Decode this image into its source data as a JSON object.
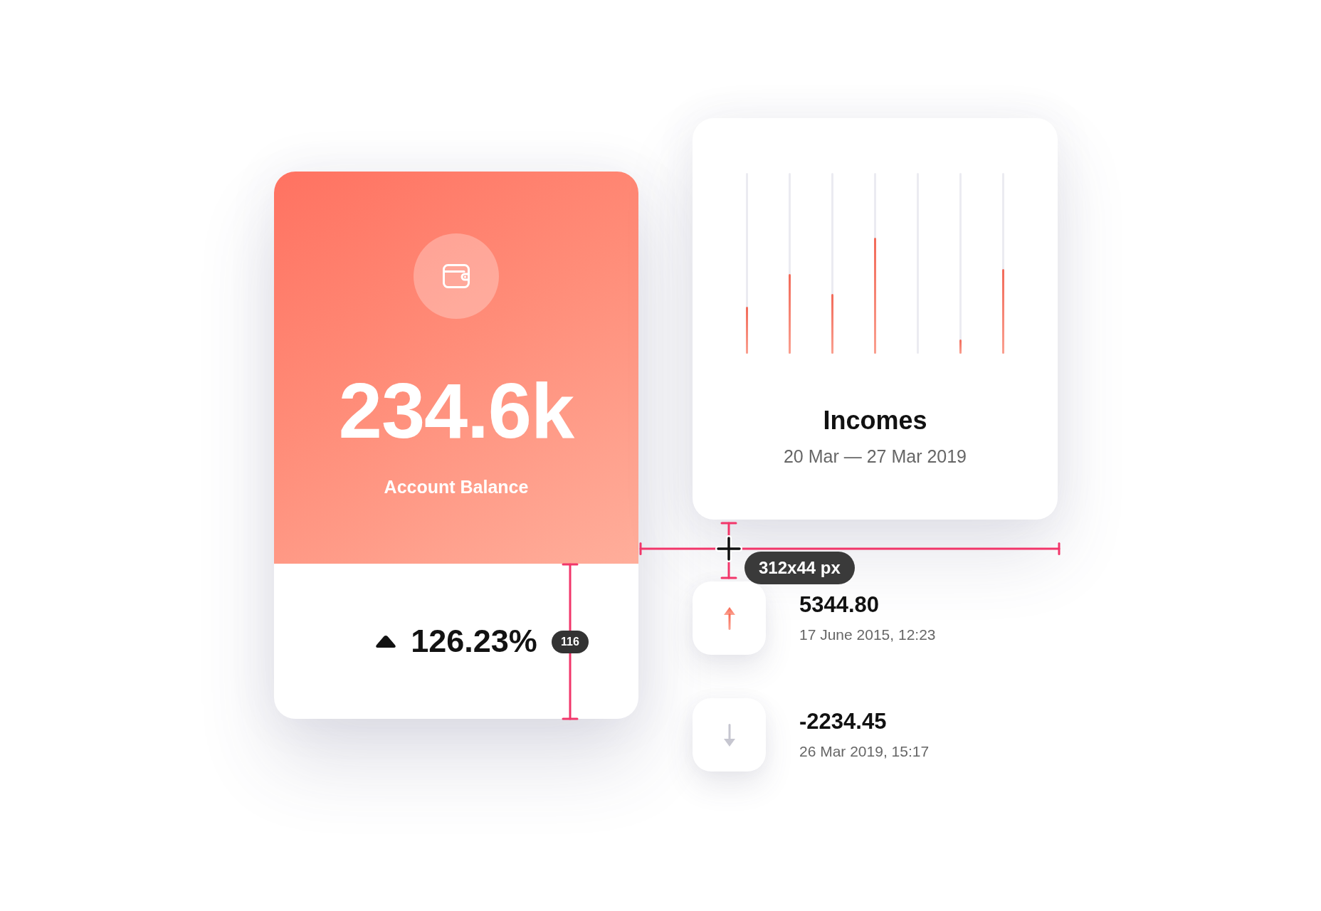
{
  "balance_card": {
    "amount": "234.6k",
    "label": "Account Balance",
    "change": "126.23%"
  },
  "incomes_card": {
    "bars": [
      {
        "level": 0.26
      },
      {
        "level": 0.44
      },
      {
        "level": 0.33
      },
      {
        "level": 0.64
      },
      {
        "level": 0
      },
      {
        "level": 0.08
      },
      {
        "level": 0.47
      }
    ],
    "title": "Incomes",
    "date_range": "20 Mar — 27 Mar 2019"
  },
  "measure_overlay": {
    "height_label": "116",
    "size_label": "312x44 px"
  },
  "transactions": [
    {
      "kind": "income",
      "amount": "5344.80",
      "date": "17 June 2015, 12:23"
    },
    {
      "kind": "expense",
      "amount": "-2234.45",
      "date": "26 Mar 2019, 15:17"
    }
  ]
}
